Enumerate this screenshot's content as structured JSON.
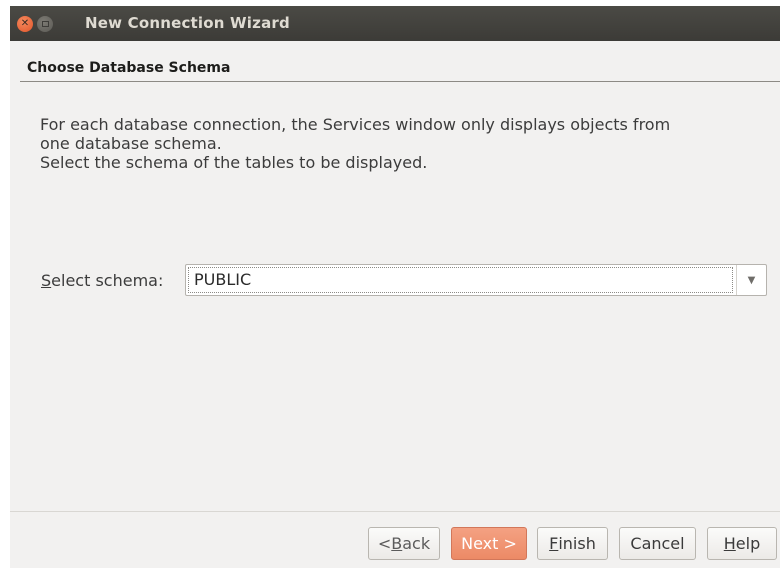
{
  "window": {
    "title": "New Connection Wizard",
    "close_icon": "close-icon",
    "maximize_icon": "maximize-icon"
  },
  "step": {
    "title": "Choose Database Schema"
  },
  "description": {
    "line1": "For each database connection, the Services window only displays objects from",
    "line2": "one database schema.",
    "line3": "Select the schema of the tables to be displayed."
  },
  "schema": {
    "label_mnemonic": "S",
    "label_rest": "elect schema:",
    "selected_value": "PUBLIC",
    "dropdown_icon": "chevron-down-icon"
  },
  "buttons": {
    "back_prefix": "< ",
    "back_mnemonic": "B",
    "back_rest": "ack",
    "next_label": "Next >",
    "finish_mnemonic": "F",
    "finish_rest": "inish",
    "cancel_label": "Cancel",
    "help_mnemonic": "H",
    "help_rest": "elp"
  },
  "colors": {
    "titlebar": "#3c3b37",
    "accent_next_button": "#ec8a66",
    "close_button": "#e2552a",
    "window_background": "#f2f1f0"
  }
}
